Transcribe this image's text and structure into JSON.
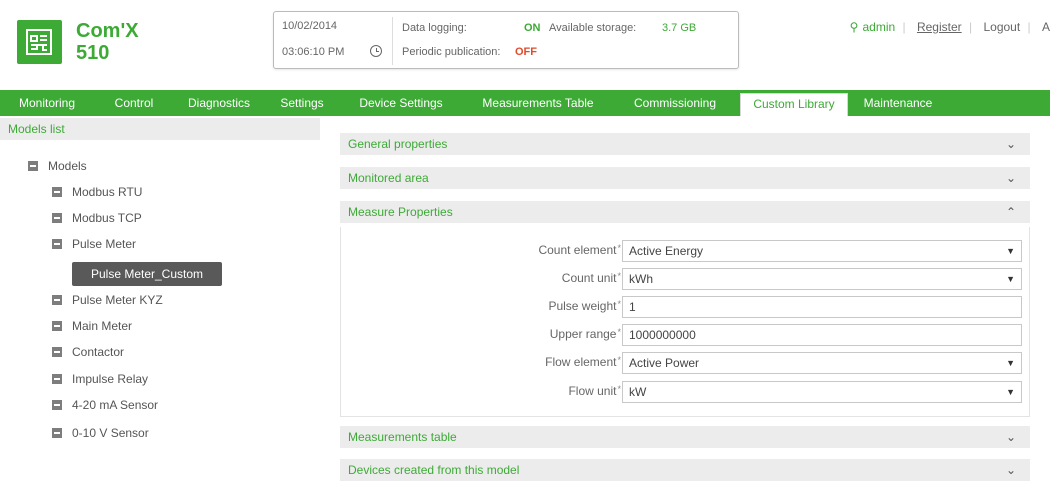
{
  "header": {
    "brand_name": "Com'X",
    "brand_model": "510",
    "date": "10/02/2014",
    "time": "03:06:10 PM",
    "data_logging_label": "Data logging:",
    "data_logging_value": "ON",
    "storage_label": "Available storage:",
    "storage_value": "3.7 GB",
    "publication_label": "Periodic publication:",
    "publication_value": "OFF",
    "user_name": "admin",
    "register_label": "Register",
    "logout_label": "Logout",
    "truncated_label": "A"
  },
  "nav": {
    "tabs": [
      {
        "label": "Monitoring"
      },
      {
        "label": "Control"
      },
      {
        "label": "Diagnostics"
      },
      {
        "label": "Settings"
      },
      {
        "label": "Device Settings"
      },
      {
        "label": "Measurements Table"
      },
      {
        "label": "Commissioning"
      },
      {
        "label": "Custom Library"
      },
      {
        "label": "Maintenance"
      }
    ],
    "active_tab": "Custom Library"
  },
  "left_pane": {
    "title": "Models list",
    "root": "Models",
    "items": [
      {
        "label": "Modbus RTU"
      },
      {
        "label": "Modbus TCP"
      },
      {
        "label": "Pulse Meter"
      },
      {
        "label": "Pulse Meter KYZ"
      },
      {
        "label": "Main Meter"
      },
      {
        "label": "Contactor"
      },
      {
        "label": "Impulse Relay"
      },
      {
        "label": "4-20 mA Sensor"
      },
      {
        "label": "0-10 V Sensor"
      }
    ],
    "selected_child": "Pulse Meter_Custom"
  },
  "sections": {
    "general": "General properties",
    "monitored": "Monitored area",
    "measure": "Measure Properties",
    "measurements_table": "Measurements table",
    "devices_created": "Devices created from this model"
  },
  "form": {
    "required_mark": "*",
    "fields": [
      {
        "label": "Count element",
        "value": "Active Energy",
        "type": "select"
      },
      {
        "label": "Count unit",
        "value": "kWh",
        "type": "select"
      },
      {
        "label": "Pulse weight",
        "value": "1",
        "type": "text"
      },
      {
        "label": "Upper range",
        "value": "1000000000",
        "type": "text"
      },
      {
        "label": "Flow element",
        "value": "Active Power",
        "type": "select"
      },
      {
        "label": "Flow unit",
        "value": "kW",
        "type": "select"
      }
    ]
  },
  "icons": {
    "logo": "network-logo-icon",
    "clock": "clock-icon",
    "user": "user-icon",
    "expand": "chevron-down-icon",
    "collapse": "chevron-up-icon",
    "tree_node": "minus-square-icon"
  },
  "colors": {
    "brand_green": "#3daa36",
    "off_red": "#e14b2a",
    "selected_bg": "#595959"
  }
}
